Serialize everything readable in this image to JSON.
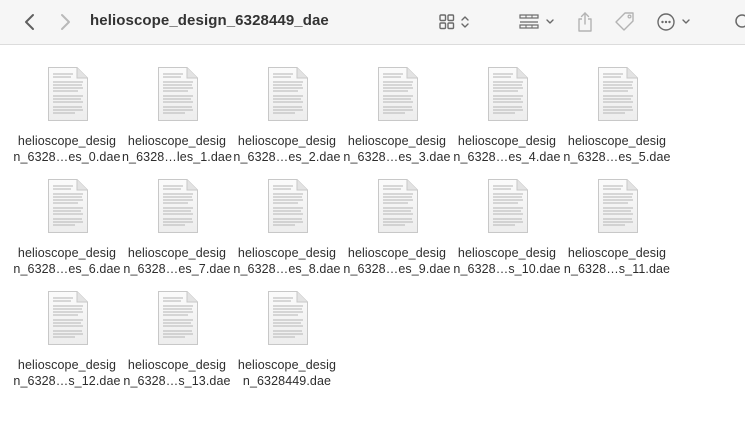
{
  "window": {
    "title": "helioscope_design_6328449_dae"
  },
  "toolbar": {
    "back_icon": "chevron-left-icon",
    "forward_icon": "chevron-right-icon",
    "view_icon": "icon-grid-view-icon",
    "group_icon": "group-by-icon",
    "share_icon": "share-icon",
    "tag_icon": "tag-icon",
    "more_icon": "ellipsis-circle-icon",
    "search_icon": "search-icon"
  },
  "files": [
    {
      "line1": "helioscope_desig",
      "line2": "n_6328…es_0.dae"
    },
    {
      "line1": "helioscope_desig",
      "line2": "n_6328…les_1.dae"
    },
    {
      "line1": "helioscope_desig",
      "line2": "n_6328…es_2.dae"
    },
    {
      "line1": "helioscope_desig",
      "line2": "n_6328…es_3.dae"
    },
    {
      "line1": "helioscope_desig",
      "line2": "n_6328…es_4.dae"
    },
    {
      "line1": "helioscope_desig",
      "line2": "n_6328…es_5.dae"
    },
    {
      "line1": "helioscope_desig",
      "line2": "n_6328…es_6.dae"
    },
    {
      "line1": "helioscope_desig",
      "line2": "n_6328…es_7.dae"
    },
    {
      "line1": "helioscope_desig",
      "line2": "n_6328…es_8.dae"
    },
    {
      "line1": "helioscope_desig",
      "line2": "n_6328…es_9.dae"
    },
    {
      "line1": "helioscope_desig",
      "line2": "n_6328…s_10.dae"
    },
    {
      "line1": "helioscope_desig",
      "line2": "n_6328…s_11.dae"
    },
    {
      "line1": "helioscope_desig",
      "line2": "n_6328…s_12.dae"
    },
    {
      "line1": "helioscope_desig",
      "line2": "n_6328…s_13.dae"
    },
    {
      "line1": "helioscope_desig",
      "line2": "n_6328449.dae"
    }
  ]
}
